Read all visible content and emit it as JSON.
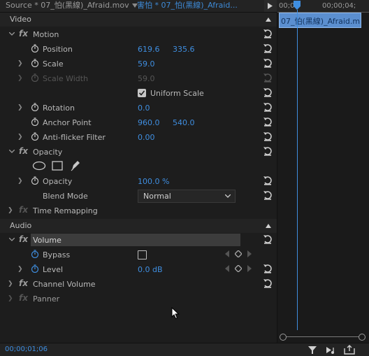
{
  "tabs": {
    "source": "Source * 07_怕(黑線)_Afraid.mov",
    "sequence": "害怕 * 07_怕(黑線)_Afraid..."
  },
  "timeline": {
    "timecode_left": "00;00",
    "timecode_right": "00;00;04;",
    "clip_name": "07_怕(黑線)_Afraid.m"
  },
  "video": {
    "section_label": "Video",
    "motion": {
      "label": "Motion",
      "position": {
        "label": "Position",
        "x": "619.6",
        "y": "335.6"
      },
      "scale": {
        "label": "Scale",
        "value": "59.0"
      },
      "scale_width": {
        "label": "Scale Width",
        "value": "59.0"
      },
      "uniform_scale": {
        "label": "Uniform Scale",
        "checked": true
      },
      "rotation": {
        "label": "Rotation",
        "value": "0.0"
      },
      "anchor_point": {
        "label": "Anchor Point",
        "x": "960.0",
        "y": "540.0"
      },
      "anti_flicker": {
        "label": "Anti-flicker Filter",
        "value": "0.00"
      }
    },
    "opacity": {
      "label": "Opacity",
      "opacity": {
        "label": "Opacity",
        "value": "100.0 %"
      },
      "blend_mode": {
        "label": "Blend Mode",
        "value": "Normal"
      }
    },
    "time_remapping": {
      "label": "Time Remapping"
    }
  },
  "audio": {
    "section_label": "Audio",
    "volume": {
      "label": "Volume",
      "bypass": {
        "label": "Bypass",
        "checked": false
      },
      "level": {
        "label": "Level",
        "value": "0.0 dB"
      }
    },
    "channel_volume": {
      "label": "Channel Volume"
    },
    "panner": {
      "label": "Panner"
    }
  },
  "status": {
    "timecode": "00;00;01;06"
  },
  "colors": {
    "accent": "#3f8ee0",
    "panel": "#1d1d1d",
    "clip": "#5b8fd0"
  }
}
